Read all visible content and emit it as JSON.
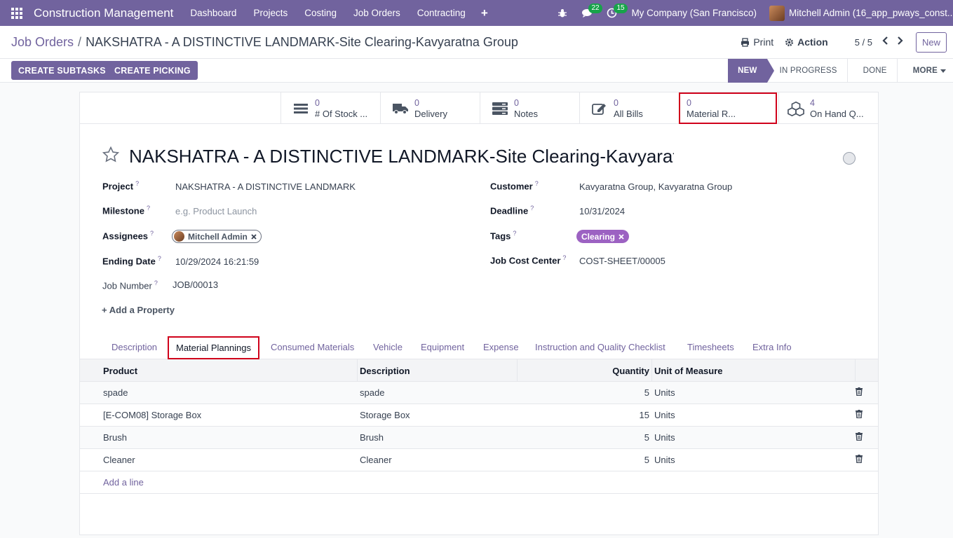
{
  "navbar": {
    "brand": "Construction Management",
    "menu": [
      "Dashboard",
      "Projects",
      "Costing",
      "Job Orders",
      "Contracting"
    ],
    "plus": "+",
    "messages_count": "22",
    "activities_count": "15",
    "company": "My Company (San Francisco)",
    "user": "Mitchell Admin (16_app_pways_const..."
  },
  "control": {
    "breadcrumb_parent": "Job Orders",
    "breadcrumb_sep": "/",
    "breadcrumb_current": "NAKSHATRA - A DISTINCTIVE LANDMARK-Site Clearing-Kavyaratna Group",
    "print": "Print",
    "action": "Action",
    "pager": "5 / 5",
    "prev": "<",
    "next": ">",
    "new": "New"
  },
  "actions": {
    "create_subtasks": "CREATE SUBTASKS",
    "create_picking": "CREATE PICKING",
    "stages": [
      "NEW",
      "IN PROGRESS",
      "DONE"
    ],
    "more": "MORE"
  },
  "smart_buttons": [
    {
      "count": "0",
      "label": "# Of Stock ...",
      "icon": "list-icon"
    },
    {
      "count": "0",
      "label": "Delivery",
      "icon": "truck-icon"
    },
    {
      "count": "0",
      "label": "Notes",
      "icon": "notes-icon"
    },
    {
      "count": "0",
      "label": "All Bills",
      "icon": "edit-icon"
    },
    {
      "count": "0",
      "label": "Material R...",
      "icon": ""
    },
    {
      "count": "4",
      "label": "On Hand Q...",
      "icon": "cubes-icon"
    }
  ],
  "form": {
    "title": "NAKSHATRA - A DISTINCTIVE LANDMARK-Site Clearing-Kavyaratna Group",
    "help": "?",
    "project_label": "Project",
    "project_value": "NAKSHATRA - A DISTINCTIVE LANDMARK",
    "milestone_label": "Milestone",
    "milestone_placeholder": "e.g. Product Launch",
    "assignees_label": "Assignees",
    "assignee": "Mitchell Admin",
    "ending_date_label": "Ending Date",
    "ending_date_value": "10/29/2024 16:21:59",
    "job_number_label": "Job Number",
    "job_number_value": "JOB/00013",
    "customer_label": "Customer",
    "customer_value": "Kavyaratna Group, Kavyaratna Group",
    "deadline_label": "Deadline",
    "deadline_value": "10/31/2024",
    "tags_label": "Tags",
    "tag": "Clearing",
    "cost_center_label": "Job Cost Center",
    "cost_center_value": "COST-SHEET/00005",
    "add_property": "Add a Property"
  },
  "tabs": [
    "Description",
    "Material Plannings",
    "Consumed Materials",
    "Vehicle",
    "Equipment",
    "Expense",
    "Instruction and Quality Checklist",
    "Timesheets",
    "Extra Info"
  ],
  "table": {
    "headers": [
      "Product",
      "Description",
      "Quantity",
      "Unit of Measure"
    ],
    "rows": [
      {
        "product": "spade",
        "description": "spade",
        "quantity": "5",
        "uom": "Units"
      },
      {
        "product": "[E-COM08] Storage Box",
        "description": "Storage Box",
        "quantity": "15",
        "uom": "Units"
      },
      {
        "product": "Brush",
        "description": "Brush",
        "quantity": "5",
        "uom": "Units"
      },
      {
        "product": "Cleaner",
        "description": "Cleaner",
        "quantity": "5",
        "uom": "Units"
      }
    ],
    "add_line": "Add a line"
  },
  "colors": {
    "brand": "#71639e",
    "highlight": "#d0021b",
    "tag": "#9c62c2",
    "badge": "#17a34a"
  }
}
